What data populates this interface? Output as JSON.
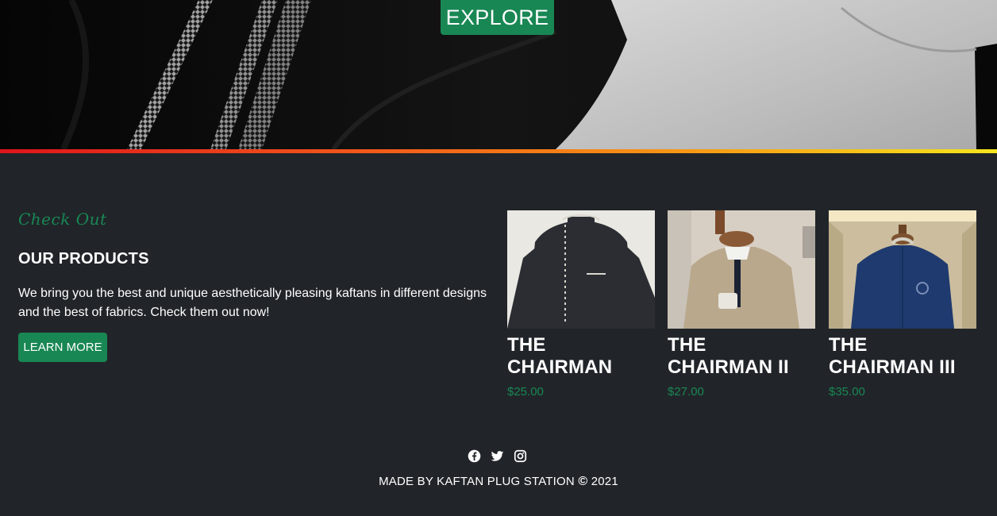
{
  "hero": {
    "explore_label": "EXPLORE"
  },
  "products_section": {
    "eyebrow": "Check Out",
    "title": "OUR PRODUCTS",
    "description": "We bring you the best and unique aesthetically pleasing kaftans in different designs and the best of fabrics. Check them out now!",
    "learn_more_label": "LEARN MORE"
  },
  "products": [
    {
      "name": "THE CHAIRMAN",
      "price": "$25.00",
      "color": "#2b2d33"
    },
    {
      "name": "THE CHAIRMAN II",
      "price": "$27.00",
      "color": "#b9a88c"
    },
    {
      "name": "THE CHAIRMAN III",
      "price": "$35.00",
      "color": "#1f3a6e"
    }
  ],
  "footer": {
    "socials": [
      "facebook-icon",
      "twitter-icon",
      "instagram-icon"
    ],
    "credit_text": "MADE BY KAFTAN PLUG STATION",
    "copyright_symbol": "©",
    "year": "2021"
  },
  "colors": {
    "accent": "#198754",
    "background": "#212529",
    "gradient": [
      "#e0141b",
      "#f79a14",
      "#f6e61c"
    ]
  }
}
